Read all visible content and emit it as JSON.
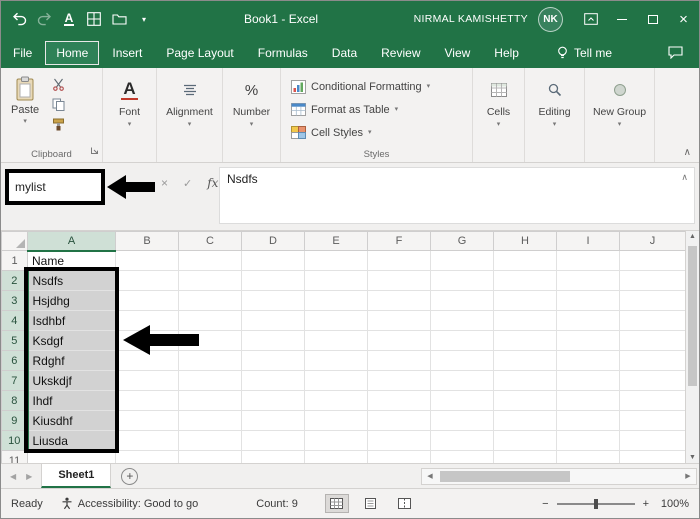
{
  "titlebar": {
    "title": "Book1 - Excel",
    "user_name": "NIRMAL KAMISHETTY",
    "user_initials": "NK"
  },
  "tabs": {
    "items": [
      "File",
      "Home",
      "Insert",
      "Page Layout",
      "Formulas",
      "Data",
      "Review",
      "View",
      "Help"
    ],
    "active": "Home",
    "tell_me_label": "Tell me"
  },
  "ribbon": {
    "paste_label": "Paste",
    "styles_buttons": [
      "Conditional Formatting",
      "Format as Table",
      "Cell Styles"
    ],
    "group_labels": {
      "clipboard": "Clipboard",
      "font": "Font",
      "alignment": "Alignment",
      "number": "Number",
      "styles": "Styles",
      "cells": "Cells",
      "editing": "Editing",
      "new_group": "New Group"
    }
  },
  "formula_bar": {
    "name_box_value": "mylist",
    "formula_value": "Nsdfs",
    "fx_label": "fx"
  },
  "grid": {
    "column_headers": [
      "A",
      "B",
      "C",
      "D",
      "E",
      "F",
      "G",
      "H",
      "I",
      "J"
    ],
    "row_count": 11,
    "column_a_values": [
      "Name",
      "Nsdfs",
      "Hsjdhg",
      "Isdhbf",
      "Ksdgf",
      "Rdghf",
      "Ukskdjf",
      "Ihdf",
      "Kiusdhf",
      "Liusda"
    ],
    "selection": {
      "column": "A",
      "first_row": 2,
      "last_row": 10
    }
  },
  "sheet_bar": {
    "active_sheet": "Sheet1"
  },
  "status_bar": {
    "mode": "Ready",
    "accessibility": "Accessibility: Good to go",
    "count": "Count: 9",
    "zoom_level": "100%"
  },
  "icons": {
    "dropdown_caret": "▾",
    "close": "×",
    "cancel": "×",
    "enter": "✓",
    "collapse_ribbon": "∧",
    "formula_toggle": "∧",
    "prev_sheet": "◀",
    "next_sheet": "▶",
    "scroll_left": "◀",
    "scroll_right": "▶",
    "scroll_up": "▲",
    "scroll_down": "▼",
    "add_sheet": "+",
    "zoom_out": "−",
    "zoom_in": "+",
    "percent": "%",
    "font_letter": "A",
    "underline_letter": "A"
  },
  "colors": {
    "excel_green": "#217346",
    "selection_fill": "#d2d2d2",
    "annotation_black": "#000000"
  }
}
